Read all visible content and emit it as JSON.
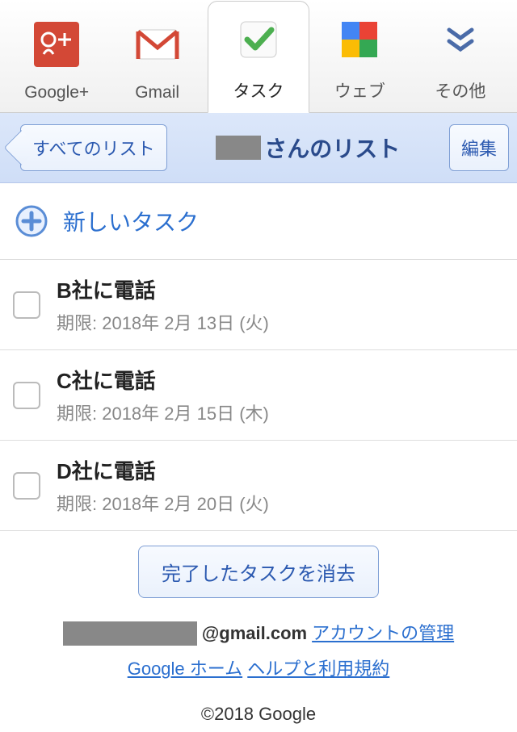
{
  "tabs": [
    {
      "label": "Google+"
    },
    {
      "label": "Gmail"
    },
    {
      "label": "タスク",
      "active": true
    },
    {
      "label": "ウェブ"
    },
    {
      "label": "その他"
    }
  ],
  "header": {
    "back_label": "すべてのリスト",
    "title_suffix": "さんのリスト",
    "edit_label": "編集"
  },
  "new_task_label": "新しいタスク",
  "tasks": [
    {
      "title": "B社に電話",
      "due": "期限: 2018年 2月 13日 (火)"
    },
    {
      "title": "C社に電話",
      "due": "期限: 2018年 2月 15日 (木)"
    },
    {
      "title": "D社に電話",
      "due": "期限: 2018年 2月 20日 (火)"
    }
  ],
  "clear_completed": "完了したタスクを消去",
  "footer": {
    "email_suffix": "@gmail.com",
    "account_manage": "アカウントの管理",
    "google_home": "Google ホーム",
    "help_terms": "ヘルプと利用規約",
    "copyright": "©2018 Google"
  }
}
